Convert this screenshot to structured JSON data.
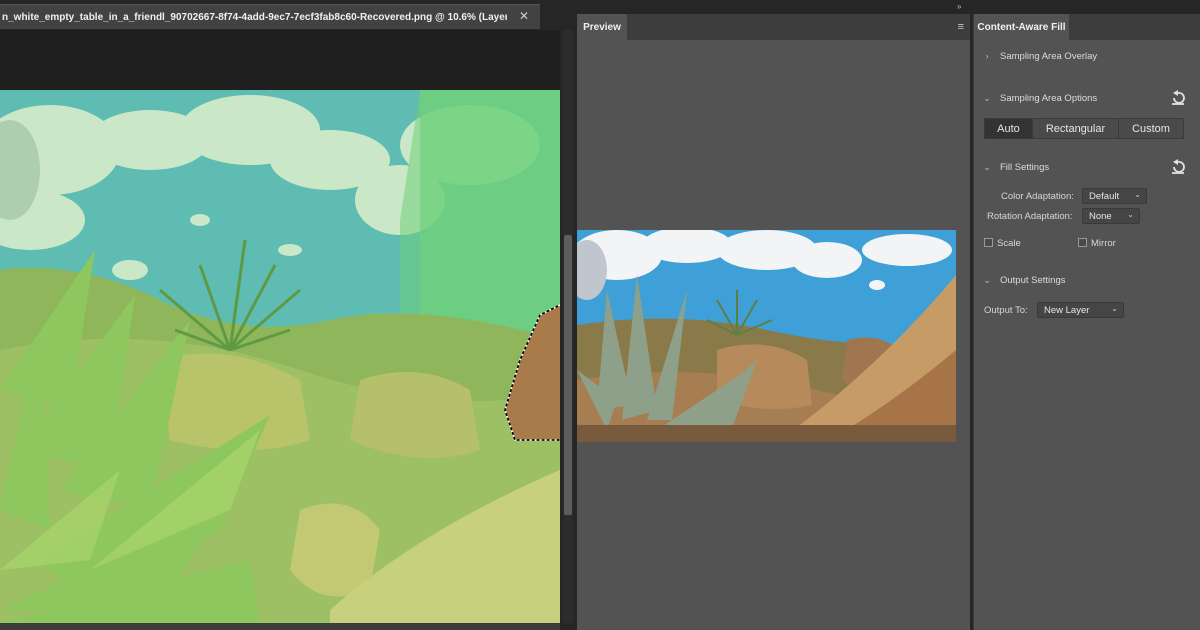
{
  "document": {
    "tab_title": "n_white_empty_table_in_a_friendl_90702667-8f74-4add-9ec7-7ecf3fab8c60-Recovered.png @ 10.6% (Layer...",
    "close_icon": "close-icon"
  },
  "preview": {
    "tab_label": "Preview",
    "menu_icon": "panel-menu-icon"
  },
  "panel": {
    "collapse_icon": "double-chevron-icon",
    "tab_label": "Content-Aware Fill",
    "sections": {
      "overlay": "Sampling Area Overlay",
      "options": "Sampling Area Options",
      "fill": "Fill Settings",
      "output": "Output Settings"
    },
    "sampling_modes": [
      "Auto",
      "Rectangular",
      "Custom"
    ],
    "active_mode": "Auto",
    "color_adaptation_label": "Color Adaptation:",
    "color_adaptation_value": "Default",
    "rotation_adaptation_label": "Rotation Adaptation:",
    "rotation_adaptation_value": "None",
    "scale_label": "Scale",
    "mirror_label": "Mirror",
    "output_to_label": "Output To:",
    "output_to_value": "New Layer"
  }
}
